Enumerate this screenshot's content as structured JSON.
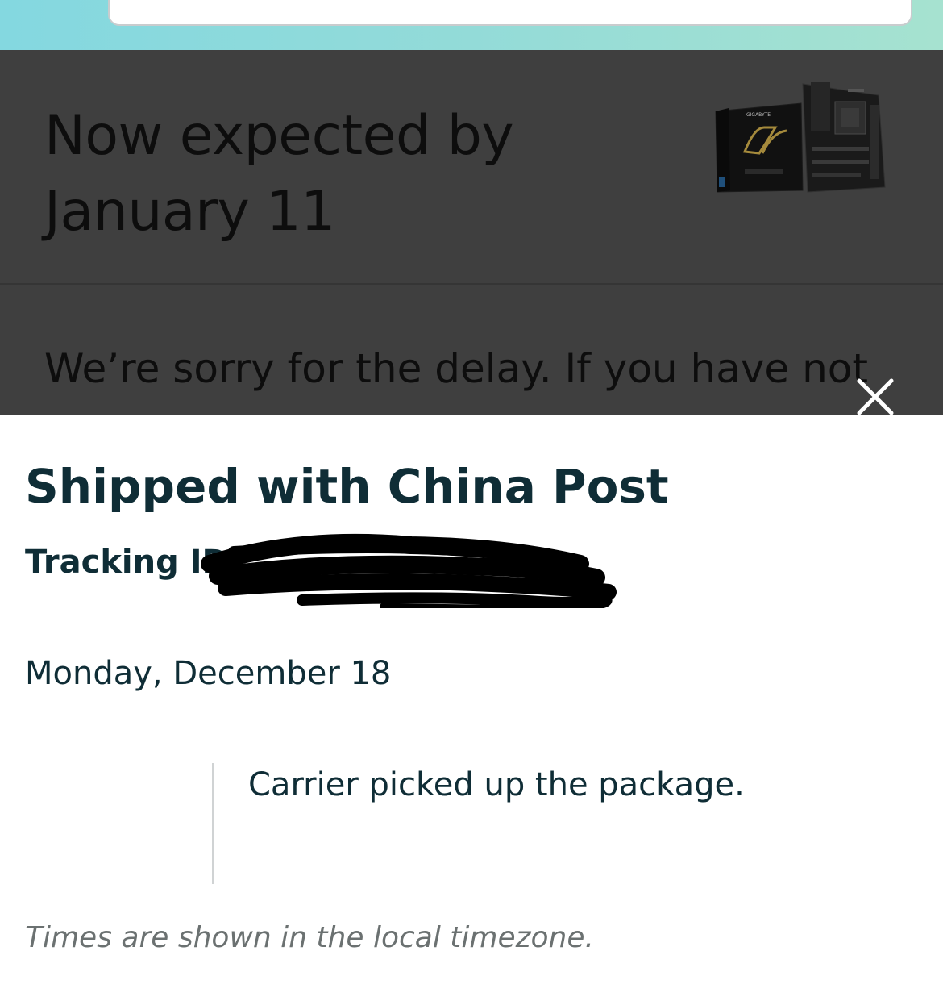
{
  "background_page": {
    "expected_line1": "Now expected by",
    "expected_line2": "January 11",
    "apology_text": "We’re sorry for the delay. If you have not",
    "product_image": "gigabyte-motherboard-box",
    "product_image_text": "GIGABYTE",
    "close_icon": "close-icon"
  },
  "sheet": {
    "title": "Shipped with China Post",
    "tracking_label": "Tracking ID:",
    "tracking_value_redacted": true,
    "date_heading": "Monday, December 18",
    "events": [
      {
        "description": "Carrier picked up the package."
      }
    ],
    "timezone_note": "Times are shown in the local timezone."
  },
  "colors": {
    "accent_text": "#0f2d36",
    "muted_text": "#6b7171",
    "overlay": "#3f3f3f",
    "header_gradient_start": "#84d8e0",
    "header_gradient_end": "#a6e2d0"
  }
}
